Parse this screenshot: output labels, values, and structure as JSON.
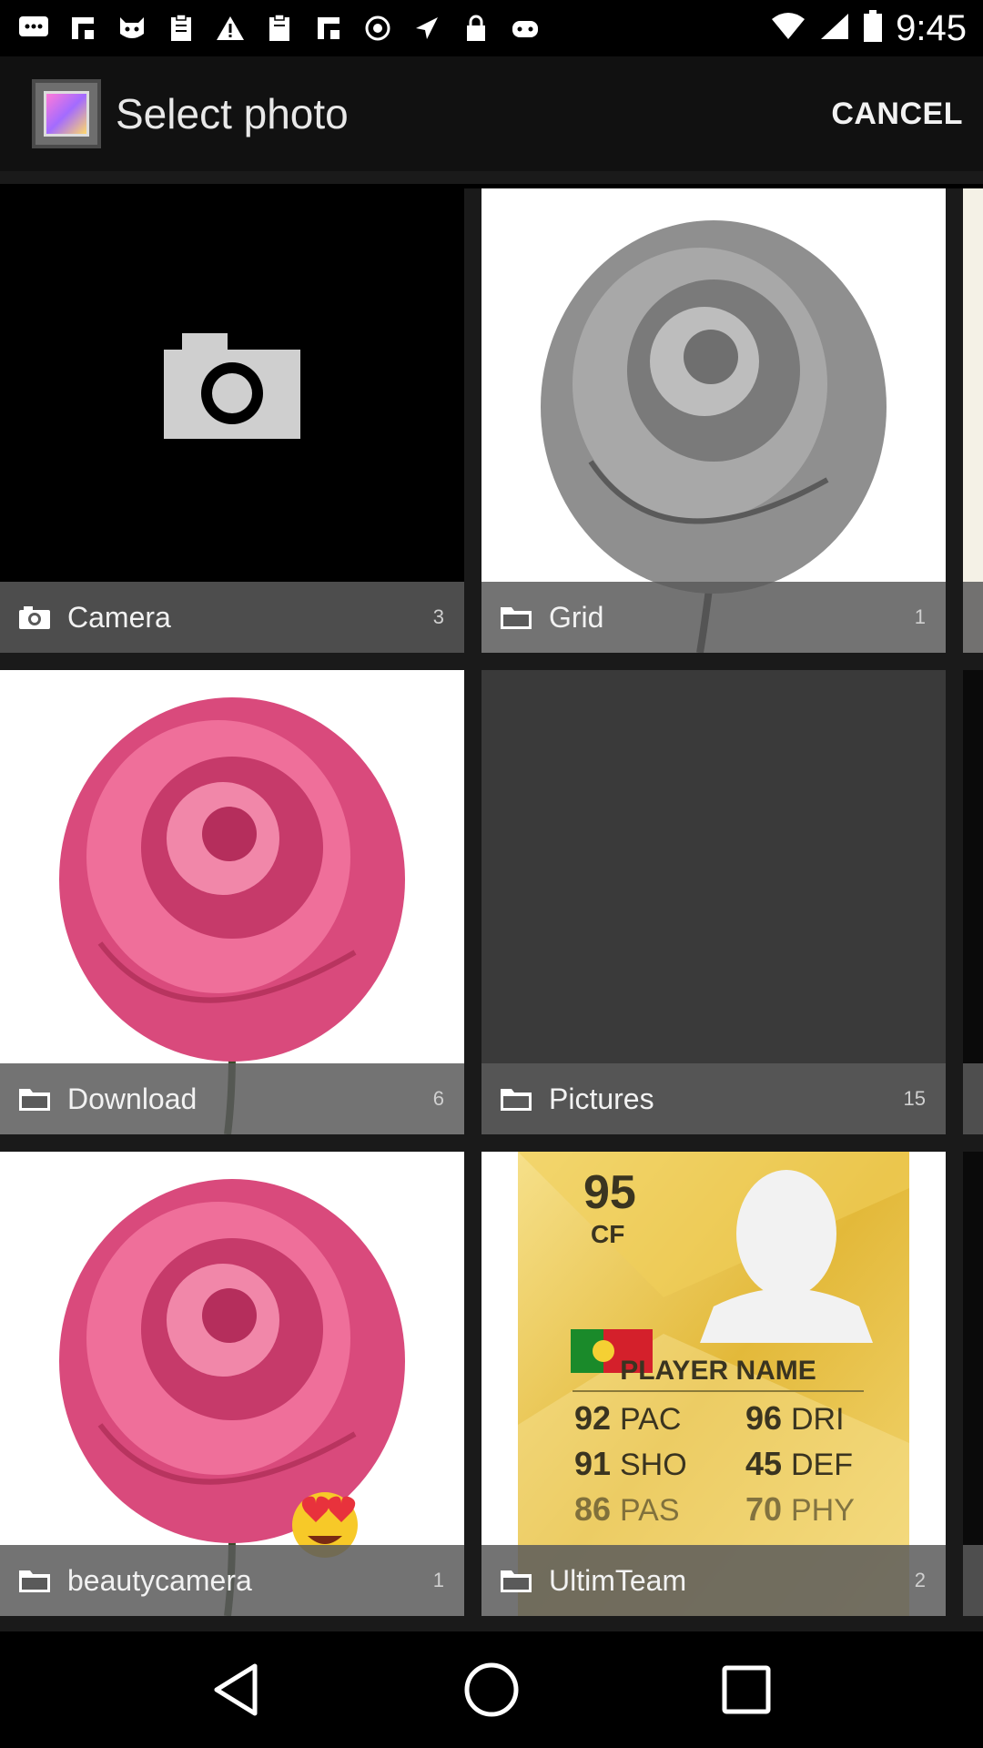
{
  "status_bar": {
    "time": "9:45",
    "left_icons": [
      "message-icon",
      "flipboard-icon",
      "cat-icon",
      "clipboard-icon",
      "warning-icon",
      "clipboard-icon",
      "flipboard-icon",
      "info-icon",
      "location-icon",
      "lock-icon",
      "game-icon"
    ],
    "right_icons": [
      "wifi-icon",
      "signal-icon",
      "battery-icon"
    ]
  },
  "app_bar": {
    "title": "Select photo",
    "cancel_label": "CANCEL"
  },
  "albums": [
    {
      "name": "Camera",
      "count": "3",
      "thumb": "camera",
      "icon": "camera-icon"
    },
    {
      "name": "Grid",
      "count": "1",
      "thumb": "grey-rose",
      "icon": "folder-icon"
    },
    {
      "name": "Download",
      "count": "6",
      "thumb": "pink-rose",
      "icon": "folder-icon"
    },
    {
      "name": "Pictures",
      "count": "15",
      "thumb": "dark",
      "icon": "folder-icon"
    },
    {
      "name": "beautycamera",
      "count": "1",
      "thumb": "pink-rose-emoji",
      "icon": "folder-icon"
    },
    {
      "name": "UltimTeam",
      "count": "2",
      "thumb": "player-card",
      "icon": "folder-icon"
    }
  ],
  "player_card": {
    "rating": "95",
    "position": "CF",
    "name": "PLAYER NAME",
    "stats": [
      "92",
      "PAC",
      "96",
      "DRI",
      "91",
      "SHO",
      "45",
      "DEF",
      "86",
      "PAS",
      "70",
      "PHY"
    ]
  },
  "colors": {
    "background": "#000000",
    "app_bar": "#111111",
    "grid_bg": "#1a1a1a",
    "label_bar": "#5a5a5a",
    "card_gold": "#e9c84a"
  }
}
